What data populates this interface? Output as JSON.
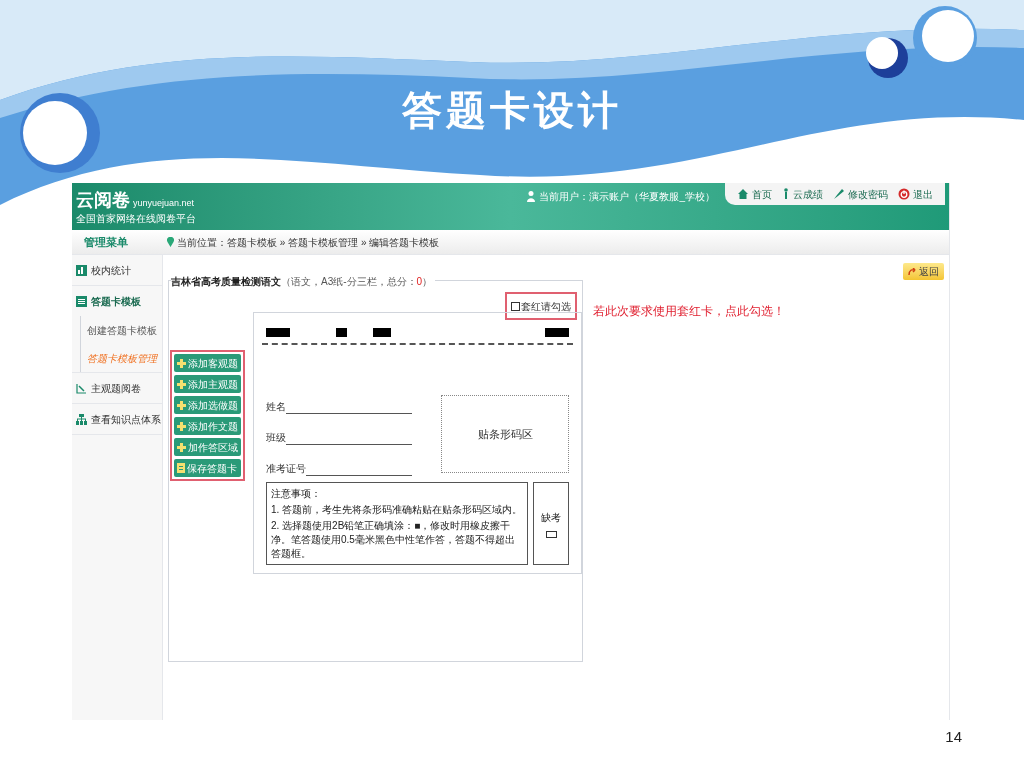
{
  "slide": {
    "title": "答题卡设计",
    "page_number": "14"
  },
  "app": {
    "logo": {
      "name": "云阅卷",
      "domain": "yunyuejuan.net",
      "slogan": "全国首家网络在线阅卷平台"
    },
    "user": "当前用户：演示账户（华夏教服_学校）",
    "nav_links": [
      {
        "label": "首页",
        "kind": "home"
      },
      {
        "label": "云成绩",
        "kind": "score"
      },
      {
        "label": "修改密码",
        "kind": "key"
      },
      {
        "label": "退出",
        "kind": "logout"
      }
    ],
    "menu_title": "管理菜单",
    "breadcrumb": "当前位置：答题卡模板 » 答题卡模板管理 » 编辑答题卡模板",
    "sidebar": [
      {
        "label": "校内统计",
        "kind": "chart",
        "expanded": false
      },
      {
        "label": "答题卡模板",
        "kind": "doc",
        "expanded": true,
        "children": [
          {
            "label": "创建答题卡模板",
            "selected": false
          },
          {
            "label": "答题卡模板管理",
            "selected": true
          }
        ]
      },
      {
        "label": "主观题阅卷",
        "kind": "pen",
        "expanded": false
      },
      {
        "label": "查看知识点体系",
        "kind": "tree",
        "expanded": false
      }
    ],
    "return_button": "返回",
    "card": {
      "title": "吉林省高考质量检测语文",
      "meta": "（语文，A3纸-分三栏，总分：",
      "score": "0",
      "meta_end": "）"
    },
    "red_checkbox": {
      "label": "套红请勾选",
      "checked": false
    },
    "hint": "若此次要求使用套红卡，点此勾选！",
    "tool_buttons": [
      {
        "label": "添加客观题",
        "kind": "add"
      },
      {
        "label": "添加主观题",
        "kind": "add"
      },
      {
        "label": "添加选做题",
        "kind": "add"
      },
      {
        "label": "添加作文题",
        "kind": "add"
      },
      {
        "label": "加作答区域",
        "kind": "add"
      },
      {
        "label": "保存答题卡",
        "kind": "save"
      }
    ],
    "sheet": {
      "fields": [
        "姓名",
        "班级",
        "准考证号"
      ],
      "barcode": "贴条形码区",
      "notes_title": "注意事项：",
      "notes": [
        "1. 答题前，考生先将条形码准确粘贴在贴条形码区域内。",
        "2. 选择题使用2B铅笔正确填涂：■，修改时用橡皮擦干净。笔答题使用0.5毫米黑色中性笔作答，答题不得超出答题框。"
      ],
      "absent": {
        "label": "缺考",
        "checked": false
      }
    }
  }
}
